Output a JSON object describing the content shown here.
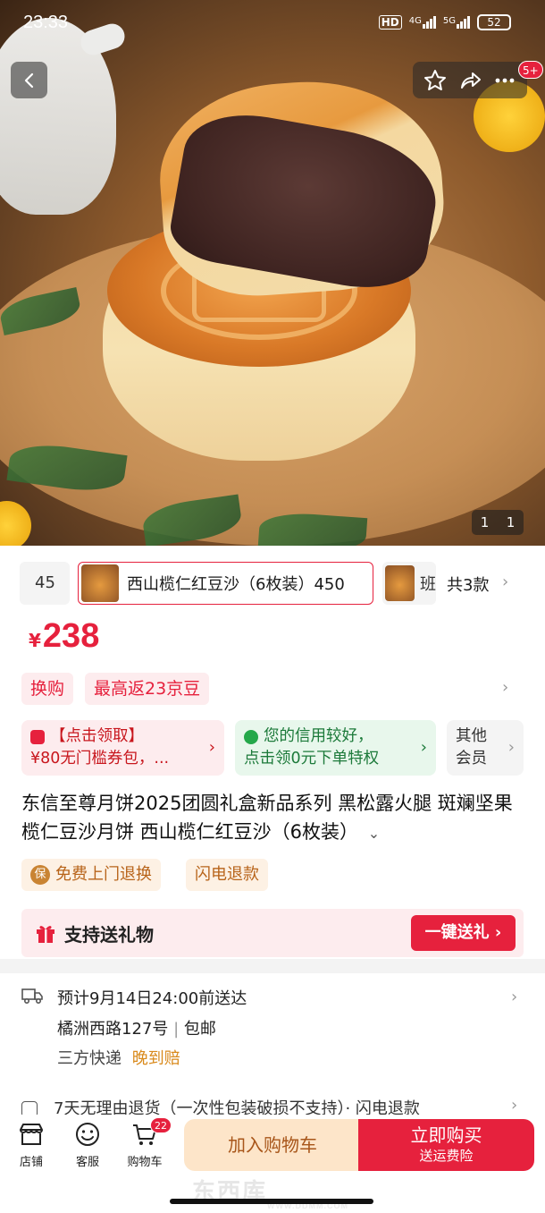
{
  "status_bar": {
    "time": "23:33",
    "net1": "HD",
    "net2": "4G",
    "net3": "5G",
    "battery": "52"
  },
  "hero": {
    "image_counter_left": "1",
    "image_counter_right": "1",
    "actions_badge": "5+"
  },
  "variants": {
    "prev_label": "45",
    "selected_label": "西山榄仁红豆沙（6枚装）450",
    "next_label": "班",
    "count_label": "共3款"
  },
  "price": {
    "currency": "¥",
    "value": "238"
  },
  "tags": {
    "exchange": "换购",
    "jingdou": "最高返23京豆"
  },
  "coupons": {
    "red_line1": "【点击领取】",
    "red_line2": "¥80无门槛券包，...",
    "green_line1": "您的信用较好，",
    "green_line2": "点击领0元下单特权",
    "gray_line1": "其他",
    "gray_line2": "会员"
  },
  "product_title": "东信至尊月饼2025团圆礼盒新品系列 黑松露火腿 斑斓坚果 榄仁豆沙月饼 西山榄仁红豆沙（6枚装）",
  "services": {
    "free_return_icon": "保",
    "free_return": "免费上门退换",
    "flash_refund": "闪电退款"
  },
  "gift": {
    "label": "支持送礼物",
    "button": "一键送礼 ›"
  },
  "delivery": {
    "eta": "预计9月14日24:00前送达",
    "address": "橘洲西路127号",
    "separator": " | ",
    "shipping": "包邮",
    "carrier": "三方快递",
    "late_comp": "晚到赔"
  },
  "returns_text": "7天无理由退货（一次性包装破损不支持）· 闪电退款",
  "bottom_nav": {
    "shop": "店铺",
    "service": "客服",
    "cart": "购物车",
    "cart_count": "22",
    "add_to_cart": "加入购物车",
    "buy_now": "立即购买",
    "buy_now_sub": "送运费险"
  },
  "watermark": {
    "main": "东西库",
    "sub": "WWW.DDMM.COM"
  },
  "colors": {
    "accent_red": "#e6213d",
    "orange_text": "#b8641a",
    "green_text": "#1c7a3a"
  }
}
